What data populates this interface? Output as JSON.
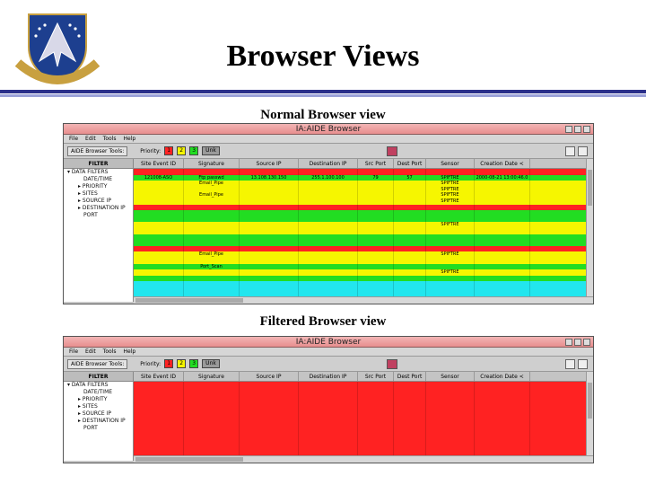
{
  "slide": {
    "title": "Browser Views",
    "caption_normal": "Normal Browser view",
    "caption_filtered": "Filtered Browser view",
    "logo_text": "88 AIR BASE WING"
  },
  "browser": {
    "window_title": "IA:AIDE Browser",
    "menu": [
      "File",
      "Edit",
      "Tools",
      "Help"
    ],
    "tools_label": "AIDE Browser Tools:",
    "priority_label": "Priority:",
    "priority_buttons": [
      "1",
      "2",
      "3",
      "Unk"
    ],
    "filter_header": "FILTER",
    "filter_tree": [
      {
        "label": "DATA FILTERS",
        "level": "root"
      },
      {
        "label": "DATE/TIME",
        "level": "leaf"
      },
      {
        "label": "PRIORITY",
        "level": "node"
      },
      {
        "label": "SITES",
        "level": "node"
      },
      {
        "label": "SOURCE IP",
        "level": "node"
      },
      {
        "label": "DESTINATION IP",
        "level": "node"
      },
      {
        "label": "PORT",
        "level": "leaf"
      }
    ],
    "columns": [
      "Site Event ID",
      "Signature",
      "Source IP",
      "Destination IP",
      "Src Port",
      "Dest Port",
      "Sensor",
      "Creation Date <"
    ]
  },
  "normal_rows": [
    {
      "color": "red",
      "cells": [
        "",
        "",
        "",
        "",
        "",
        "",
        "",
        ""
      ]
    },
    {
      "color": "green",
      "cells": [
        "121008-ASO",
        "Ftp passwd",
        "13.108.130.150",
        "255.1.100.100",
        "79",
        "57",
        "SPIFTRE",
        "2000-08-21 13:00:46.0"
      ]
    },
    {
      "color": "yellow",
      "cells": [
        "",
        "Email_Pipe",
        "",
        "",
        "",
        "",
        "SPIFTRE",
        ""
      ]
    },
    {
      "color": "yellow",
      "cells": [
        "",
        "",
        "",
        "",
        "",
        "",
        "SPIFTRE",
        ""
      ]
    },
    {
      "color": "yellow",
      "cells": [
        "",
        "Email_Pipe",
        "",
        "",
        "",
        "",
        "SPIFTRE",
        ""
      ]
    },
    {
      "color": "yellow",
      "cells": [
        "",
        "",
        "",
        "",
        "",
        "",
        "SPIFTRE",
        ""
      ]
    },
    {
      "color": "red",
      "cells": [
        "",
        "",
        "",
        "",
        "",
        "",
        "",
        ""
      ]
    },
    {
      "color": "green",
      "cells": [
        "",
        "",
        "",
        "",
        "",
        "",
        "",
        ""
      ]
    },
    {
      "color": "green",
      "cells": [
        "",
        "",
        "",
        "",
        "",
        "",
        "",
        ""
      ]
    },
    {
      "color": "yellow",
      "cells": [
        "",
        "",
        "",
        "",
        "",
        "",
        "SPIFTRE",
        ""
      ]
    },
    {
      "color": "yellow",
      "cells": [
        "",
        "",
        "",
        "",
        "",
        "",
        "",
        ""
      ]
    },
    {
      "color": "green",
      "cells": [
        "",
        "",
        "",
        "",
        "",
        "",
        "",
        ""
      ]
    },
    {
      "color": "green",
      "cells": [
        "",
        "",
        "",
        "",
        "",
        "",
        "",
        ""
      ]
    },
    {
      "color": "red",
      "cells": [
        "",
        "",
        "",
        "",
        "",
        "",
        "",
        ""
      ]
    },
    {
      "color": "yellow",
      "cells": [
        "",
        "Email_Pipe",
        "",
        "",
        "",
        "",
        "SPIFTRE",
        ""
      ]
    },
    {
      "color": "yellow",
      "cells": [
        "",
        "",
        "",
        "",
        "",
        "",
        "",
        ""
      ]
    },
    {
      "color": "green",
      "cells": [
        "",
        "Port_Scan",
        "",
        "",
        "",
        "",
        "",
        ""
      ]
    },
    {
      "color": "yellow",
      "cells": [
        "",
        "",
        "",
        "",
        "",
        "",
        "SPIFTRE",
        ""
      ]
    },
    {
      "color": "green",
      "cells": [
        "",
        "",
        "",
        "",
        "",
        "",
        "",
        ""
      ]
    },
    {
      "color": "cyan",
      "cells": [
        "",
        "",
        "",
        "",
        "",
        "",
        "",
        ""
      ]
    },
    {
      "color": "cyan",
      "cells": [
        "",
        "",
        "",
        "",
        "",
        "",
        "",
        ""
      ]
    },
    {
      "color": "cyan",
      "cells": [
        "",
        "",
        "",
        "",
        "",
        "",
        "",
        ""
      ]
    }
  ],
  "filtered_rows": [
    {
      "color": "red",
      "cells": [
        "",
        "",
        "",
        "",
        "",
        "",
        "",
        ""
      ]
    },
    {
      "color": "red",
      "cells": [
        "",
        "",
        "",
        "",
        "",
        "",
        "",
        ""
      ]
    },
    {
      "color": "red",
      "cells": [
        "",
        "",
        "",
        "",
        "",
        "",
        "",
        ""
      ]
    },
    {
      "color": "red",
      "cells": [
        "",
        "",
        "",
        "",
        "",
        "",
        "",
        ""
      ]
    },
    {
      "color": "red",
      "cells": [
        "",
        "",
        "",
        "",
        "",
        "",
        "",
        ""
      ]
    },
    {
      "color": "red",
      "cells": [
        "",
        "",
        "",
        "",
        "",
        "",
        "",
        ""
      ]
    },
    {
      "color": "red",
      "cells": [
        "",
        "",
        "",
        "",
        "",
        "",
        "",
        ""
      ]
    },
    {
      "color": "red",
      "cells": [
        "",
        "",
        "",
        "",
        "",
        "",
        "",
        ""
      ]
    },
    {
      "color": "red",
      "cells": [
        "",
        "",
        "",
        "",
        "",
        "",
        "",
        ""
      ]
    },
    {
      "color": "red",
      "cells": [
        "",
        "",
        "",
        "",
        "",
        "",
        "",
        ""
      ]
    },
    {
      "color": "red",
      "cells": [
        "",
        "",
        "",
        "",
        "",
        "",
        "",
        ""
      ]
    },
    {
      "color": "red",
      "cells": [
        "",
        "",
        "",
        "",
        "",
        "",
        "",
        ""
      ]
    },
    {
      "color": "red",
      "cells": [
        "",
        "",
        "",
        "",
        "",
        "",
        "",
        ""
      ]
    },
    {
      "color": "red",
      "cells": [
        "",
        "",
        "",
        "",
        "",
        "",
        "",
        ""
      ]
    },
    {
      "color": "red",
      "cells": [
        "",
        "",
        "",
        "",
        "",
        "",
        "",
        ""
      ]
    },
    {
      "color": "red",
      "cells": [
        "",
        "",
        "",
        "",
        "",
        "",
        "",
        ""
      ]
    },
    {
      "color": "red",
      "cells": [
        "",
        "",
        "",
        "",
        "",
        "",
        "",
        ""
      ]
    },
    {
      "color": "red",
      "cells": [
        "",
        "",
        "",
        "",
        "",
        "",
        "",
        ""
      ]
    },
    {
      "color": "red",
      "cells": [
        "",
        "",
        "",
        "",
        "",
        "",
        "",
        ""
      ]
    },
    {
      "color": "red",
      "cells": [
        "",
        "",
        "",
        "",
        "",
        "",
        "",
        ""
      ]
    }
  ],
  "colors": {
    "red": "#ff2222",
    "yellow": "#f6f600",
    "green": "#22dd22",
    "cyan": "#22e6ee",
    "title_bar": "#e88e8e",
    "rule": "#2a2f8a"
  }
}
